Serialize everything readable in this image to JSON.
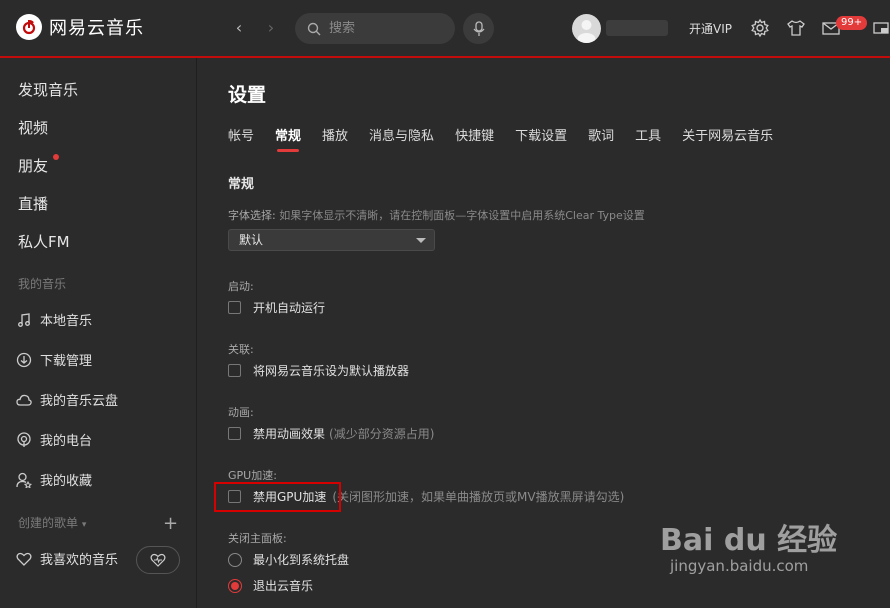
{
  "app": {
    "name": "网易云音乐"
  },
  "topbar": {
    "search_placeholder": "搜索",
    "vip": "开通VIP",
    "badge": "99+"
  },
  "sidebar": {
    "nav": [
      "发现音乐",
      "视频",
      "朋友",
      "直播",
      "私人FM"
    ],
    "my_music_label": "我的音乐",
    "my_music": [
      {
        "icon": "music-note-icon",
        "label": "本地音乐"
      },
      {
        "icon": "download-icon",
        "label": "下载管理"
      },
      {
        "icon": "cloud-icon",
        "label": "我的音乐云盘"
      },
      {
        "icon": "radio-icon",
        "label": "我的电台"
      },
      {
        "icon": "collection-icon",
        "label": "我的收藏"
      }
    ],
    "created_playlists_label": "创建的歌单",
    "liked": "我喜欢的音乐"
  },
  "settings": {
    "title": "设置",
    "tabs": [
      "帐号",
      "常规",
      "播放",
      "消息与隐私",
      "快捷键",
      "下载设置",
      "歌词",
      "工具",
      "关于网易云音乐"
    ],
    "active_tab": "常规",
    "section": "常规",
    "font_label": "字体选择:",
    "font_hint": "如果字体显示不清晰，请在控制面板—字体设置中启用系统Clear Type设置",
    "font_value": "默认",
    "startup_label": "启动:",
    "startup_option": "开机自动运行",
    "assoc_label": "关联:",
    "assoc_option": "将网易云音乐设为默认播放器",
    "anim_label": "动画:",
    "anim_option": "禁用动画效果",
    "anim_note": "(减少部分资源占用)",
    "gpu_label": "GPU加速:",
    "gpu_option": "禁用GPU加速",
    "gpu_note": "(关闭图形加速，如果单曲播放页或MV播放黑屏请勾选)",
    "close_label": "关闭主面板:",
    "close_opt1": "最小化到系统托盘",
    "close_opt2": "退出云音乐"
  },
  "watermark": {
    "main": "Bai du 经验",
    "sub": "jingyan.baidu.com"
  },
  "colors": {
    "accent": "#e33a3a",
    "background": "#2b2b2b",
    "highlight_box": "#d50000"
  }
}
